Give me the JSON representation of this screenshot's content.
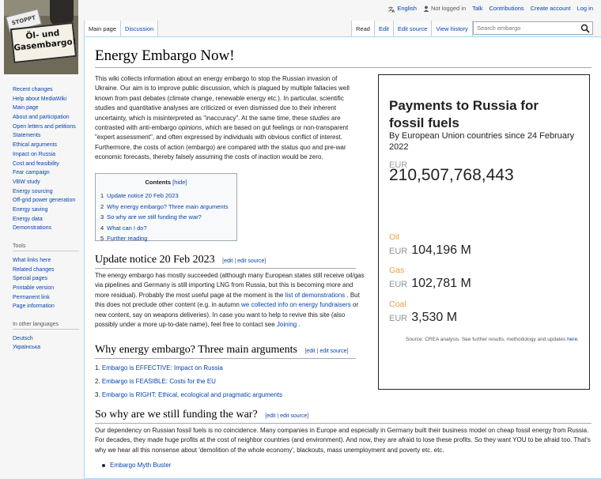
{
  "logo": {
    "stoppt": "STOPPT",
    "line1": "Öl- und",
    "line2": "Gasembargo!"
  },
  "personal_tools": {
    "language": "English",
    "not_logged_in": "Not logged in",
    "talk": "Talk",
    "contributions": "Contributions",
    "create_account": "Create account",
    "log_in": "Log in"
  },
  "tabs_left": [
    "Main page",
    "Discussion"
  ],
  "tabs_right": [
    "Read",
    "Edit",
    "Edit source",
    "View history"
  ],
  "search": {
    "placeholder": "Search embargo"
  },
  "sidebar": {
    "navigation": [
      "Recent changes",
      "Help about MediaWiki",
      "Main page",
      "About and participation",
      "Open letters and petitions",
      "Statements",
      "Ethical arguments",
      "Impact on Russia",
      "Cost and feasibility",
      "Fear campaign",
      "VBW study",
      "Energy sourcing",
      "Off-grid power generation",
      "Energy saving",
      "Energy data",
      "Demonstrations"
    ],
    "tools_heading": "Tools",
    "tools": [
      "What links here",
      "Related changes",
      "Special pages",
      "Printable version",
      "Permanent link",
      "Page information"
    ],
    "languages_heading": "In other languages",
    "languages": [
      "Deutsch",
      "Українська"
    ]
  },
  "page": {
    "title": "Energy Embargo Now!",
    "intro_a": "This wiki collects information about an energy embargo to stop the Russian invasion of Ukraine. Our aim is to improve public discussion, which is plagued by multiple fallacies well known from past debates (climate change, renewable energy etc.). In particular, scientific studies and quantitative analyses are criticized or even dismissed due to their inherent uncertainty, which is misinterpreted as \"inaccuracy\". At the same time, these ",
    "intro_studies": "studies",
    "intro_b": " are contrasted with anti-embargo ",
    "intro_opinions": "opinions",
    "intro_c": ", which are based on gut feelings or non-transparent \"expert assessment\", and often expressed by individuals with obvious conflict of interest. Furthermore, the costs of action (embargo) are compared with the status quo and pre-war economic forecasts, thereby falsely assuming the costs of inaction would be zero.",
    "toc": {
      "title": "Contents",
      "hide": "[hide]",
      "items": [
        {
          "num": "1",
          "label": "Update notice 20 Feb 2023"
        },
        {
          "num": "2",
          "label": "Why energy embargo? Three main arguments"
        },
        {
          "num": "3",
          "label": "So why are we still funding the war?"
        },
        {
          "num": "4",
          "label": "What can I do?"
        },
        {
          "num": "5",
          "label": "Further reading"
        }
      ]
    },
    "edit_links": {
      "open": "[",
      "edit": "edit",
      "sep": " | ",
      "edit_source": "edit source",
      "close": "]"
    },
    "update": {
      "heading": "Update notice 20 Feb 2023",
      "text_a": "The energy embargo has mostly succeeded (although many European states still receive oil/gas via pipelines and Germany is still importing LNG from Russia, but this is becoming more and more residual). Probably the most useful page at the moment is the ",
      "link_demos": "list of demonstrations",
      "text_b": " . But this does not preclude other content (e.g. in autumn ",
      "link_info": "we collected info on energy fundraisers",
      "text_c": " or new content, say on weapons deliveries). In case you want to help to revive this site (also possibly under a more up-to-date name), feel free to contact see ",
      "link_joining": "Joining",
      "text_d": " ."
    },
    "why": {
      "heading": "Why energy embargo? Three main arguments",
      "items": [
        "Embargo is EFFECTIVE: Impact on Russia",
        "Embargo is FEASIBLE: Costs for the EU",
        "Embargo is RIGHT: Ethical, ecological and pragmatic arguments"
      ]
    },
    "still": {
      "heading": "So why are we still funding the war?",
      "text": "Our dependency on Russian fossil fuels is no coincidence. Many companies in Europe and especially in Germany built their business model on cheap fossil energy from Russia. For decades, they made huge profits at the cost of neighbor countries (and environment). And now, they are afraid to lose these profits. So they want YOU to be afraid too. That's why we hear all this nonsense about 'demolition of the whole economy', blackouts, mass unemployment and poverty etc. etc.",
      "bullets": [
        "Embargo Myth Buster"
      ]
    }
  },
  "payments": {
    "title": "Payments to Russia for fossil fuels",
    "subtitle": "By European Union countries since 24 February 2022",
    "currency": "EUR",
    "total": "210,507,768,443",
    "fuels": [
      {
        "name": "Oil",
        "amount": "104,196 M"
      },
      {
        "name": "Gas",
        "amount": "102,781 M"
      },
      {
        "name": "Coal",
        "amount": "3,530 M"
      }
    ],
    "source_text": "Source: CREA analysis. See further results, methodology and updates ",
    "source_link": "here."
  },
  "colors": {
    "link": "#0645ad",
    "fuel_label": "#e6a23c",
    "border": "#a7d7f9"
  }
}
